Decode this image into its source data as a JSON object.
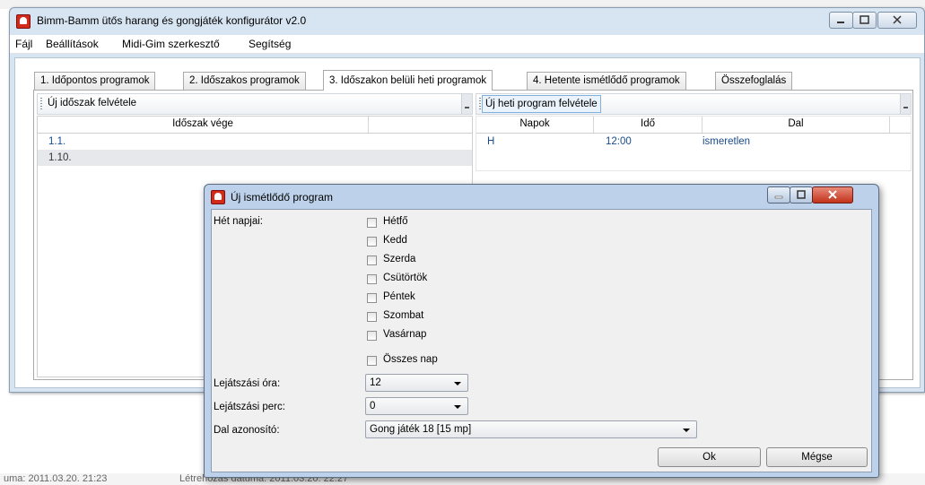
{
  "background": {
    "status_left": "uma: 2011.03.20. 21:23",
    "status_right": "Létrehozás dátuma: 2011.03.20. 22:27"
  },
  "main_window": {
    "title": "Bimm-Bamm ütős harang és gongjáték konfigurátor v2.0",
    "menu": [
      "Fájl",
      "Beállítások",
      "Midi-Gim szerkesztő",
      "Segítség"
    ],
    "tabs": [
      "1. Időpontos programok",
      "2. Időszakos programok",
      "3. Időszakon belüli heti programok",
      "4. Hetente ismétlődő programok",
      "Összefoglalás"
    ],
    "active_tab_index": 2,
    "left_toolbar_button": "Új időszak felvétele",
    "left_grid": {
      "headers": [
        "Időszak vége"
      ],
      "rows": [
        "1.1.",
        "1.10."
      ],
      "selected_row_index": 1
    },
    "right_toolbar_button": "Új heti program felvétele",
    "right_grid": {
      "headers": [
        "Napok",
        "Idő",
        "Dal"
      ],
      "rows": [
        {
          "napok": "H",
          "ido": "12:00",
          "dal": "ismeretlen"
        }
      ]
    }
  },
  "dialog": {
    "title": "Új ismétlődő program",
    "week_days_label": "Hét napjai:",
    "days": [
      "Hétfő",
      "Kedd",
      "Szerda",
      "Csütörtök",
      "Péntek",
      "Szombat",
      "Vasárnap"
    ],
    "all_days_label": "Összes nap",
    "hour_label": "Lejátszási óra:",
    "hour_value": "12",
    "minute_label": "Lejátszási perc:",
    "minute_value": "0",
    "song_label": "Dal azonosító:",
    "song_value": "Gong játék 18  [15 mp]",
    "ok_label": "Ok",
    "cancel_label": "Mégse"
  }
}
